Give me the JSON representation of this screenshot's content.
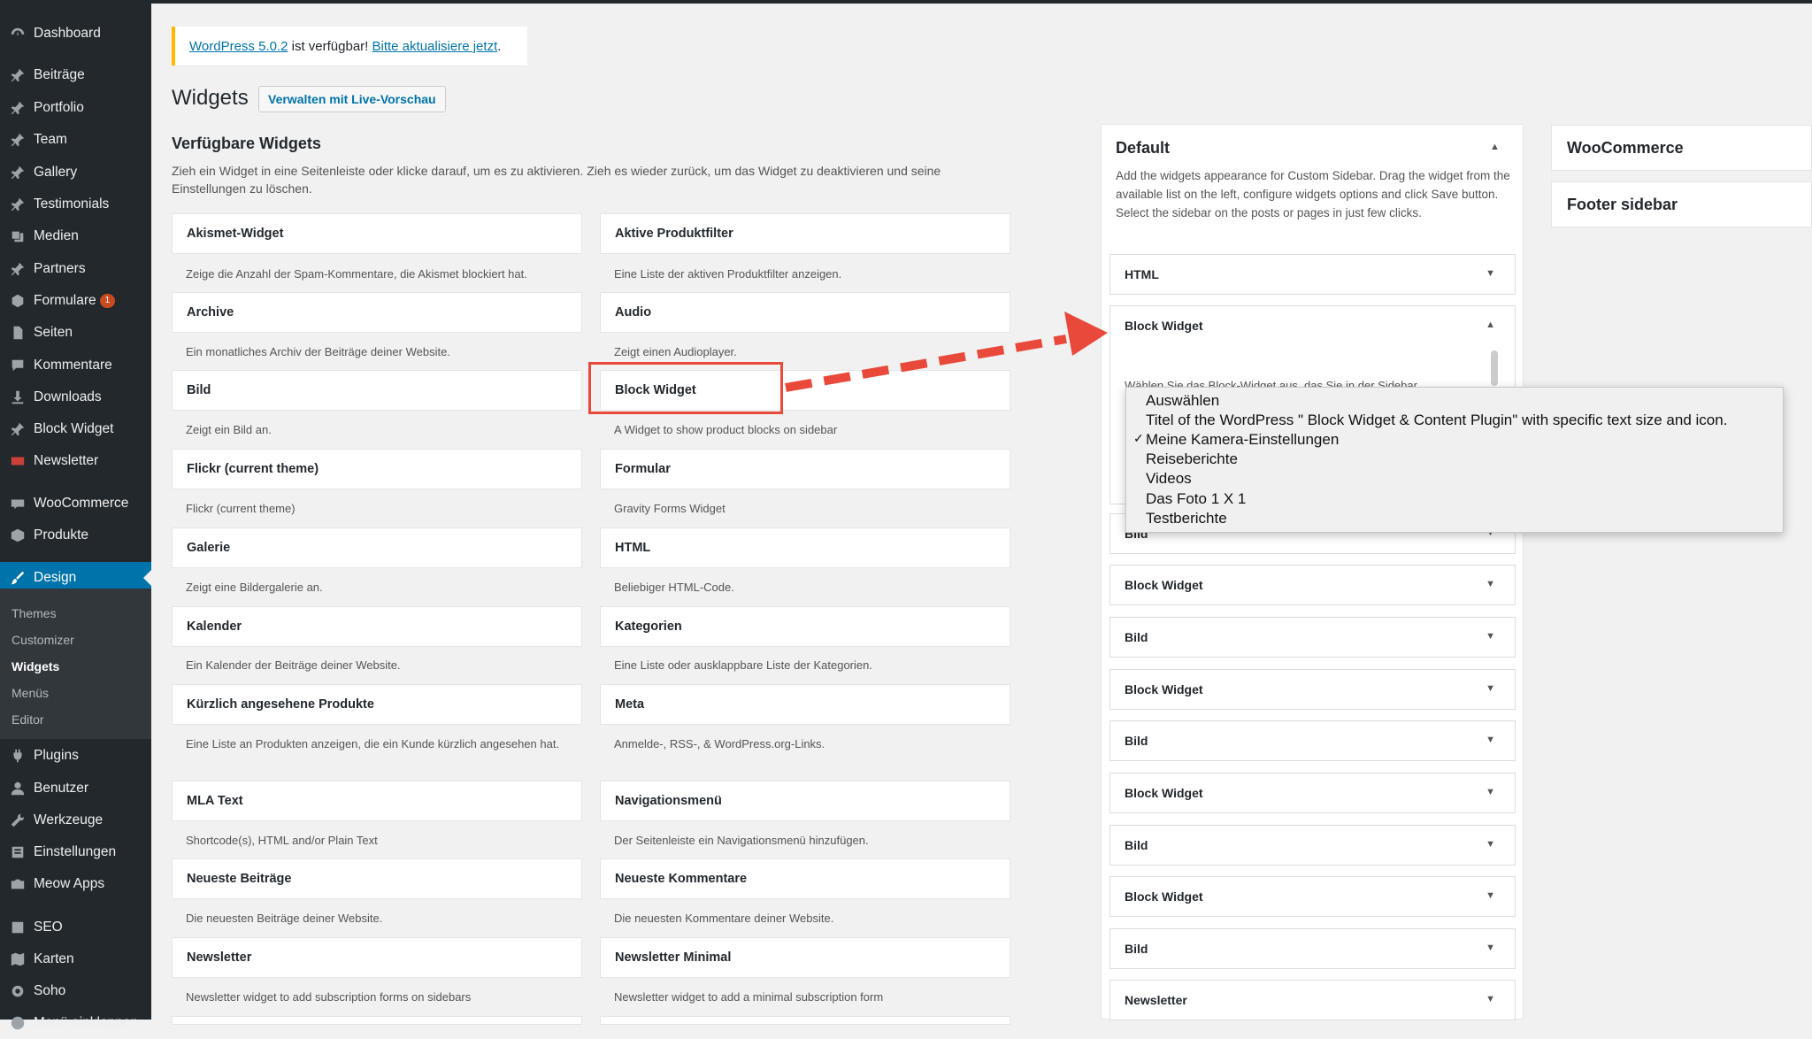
{
  "sidebar": {
    "items": [
      {
        "label": "Dashboard",
        "icon": "dashboard-icon"
      },
      {
        "label": "Beiträge",
        "icon": "pin-icon"
      },
      {
        "label": "Portfolio",
        "icon": "pin-icon"
      },
      {
        "label": "Team",
        "icon": "pin-icon"
      },
      {
        "label": "Gallery",
        "icon": "pin-icon"
      },
      {
        "label": "Testimonials",
        "icon": "pin-icon"
      },
      {
        "label": "Medien",
        "icon": "media-icon"
      },
      {
        "label": "Partners",
        "icon": "pin-icon"
      },
      {
        "label": "Formulare",
        "icon": "forms-icon",
        "badge": "1"
      },
      {
        "label": "Seiten",
        "icon": "page-icon"
      },
      {
        "label": "Kommentare",
        "icon": "comment-icon"
      },
      {
        "label": "Downloads",
        "icon": "download-icon"
      },
      {
        "label": "Block Widget",
        "icon": "pin-icon"
      },
      {
        "label": "Newsletter",
        "icon": "mail-icon"
      },
      {
        "label": "WooCommerce",
        "icon": "woo-icon"
      },
      {
        "label": "Produkte",
        "icon": "box-icon"
      },
      {
        "label": "Design",
        "icon": "brush-icon"
      },
      {
        "label": "Plugins",
        "icon": "plugin-icon"
      },
      {
        "label": "Benutzer",
        "icon": "user-icon"
      },
      {
        "label": "Werkzeuge",
        "icon": "wrench-icon"
      },
      {
        "label": "Einstellungen",
        "icon": "settings-icon"
      },
      {
        "label": "Meow Apps",
        "icon": "camera-icon"
      },
      {
        "label": "SEO",
        "icon": "seo-icon"
      },
      {
        "label": "Karten",
        "icon": "map-icon"
      },
      {
        "label": "Soho",
        "icon": "gear-icon"
      },
      {
        "label": "Menü einklappen",
        "icon": "collapse-icon"
      }
    ],
    "submenu": [
      "Themes",
      "Customizer",
      "Widgets",
      "Menüs",
      "Editor"
    ]
  },
  "notice": {
    "link1": "WordPress 5.0.2",
    "text": " ist verfügbar! ",
    "link2": "Bitte aktualisiere jetzt",
    "end": "."
  },
  "page": {
    "title": "Widgets",
    "action": "Verwalten mit Live-Vorschau",
    "available_title": "Verfügbare Widgets",
    "available_desc": "Zieh ein Widget in eine Seitenleiste oder klicke darauf, um es zu aktivieren. Zieh es wieder zurück, um das Widget zu deaktivieren und seine Einstellungen zu löschen."
  },
  "widgets": [
    {
      "name": "Akismet-Widget",
      "desc": "Zeige die Anzahl der Spam-Kommentare, die Akismet blockiert hat."
    },
    {
      "name": "Aktive Produktfilter",
      "desc": "Eine Liste der aktiven Produktfilter anzeigen."
    },
    {
      "name": "Archive",
      "desc": "Ein monatliches Archiv der Beiträge deiner Website."
    },
    {
      "name": "Audio",
      "desc": "Zeigt einen Audioplayer."
    },
    {
      "name": "Bild",
      "desc": "Zeigt ein Bild an."
    },
    {
      "name": "Block Widget",
      "desc": "A Widget to show product blocks on sidebar"
    },
    {
      "name": "Flickr (current theme)",
      "desc": "Flickr (current theme)"
    },
    {
      "name": "Formular",
      "desc": "Gravity Forms Widget"
    },
    {
      "name": "Galerie",
      "desc": "Zeigt eine Bildergalerie an."
    },
    {
      "name": "HTML",
      "desc": "Beliebiger HTML-Code."
    },
    {
      "name": "Kalender",
      "desc": "Ein Kalender der Beiträge deiner Website."
    },
    {
      "name": "Kategorien",
      "desc": "Eine Liste oder ausklappbare Liste der Kategorien."
    },
    {
      "name": "Kürzlich angesehene Produkte",
      "desc": "Eine Liste an Produkten anzeigen, die ein Kunde kürzlich angesehen hat."
    },
    {
      "name": "Meta",
      "desc": "Anmelde-, RSS-, & WordPress.org-Links."
    },
    {
      "name": "MLA Text",
      "desc": "Shortcode(s), HTML and/or Plain Text"
    },
    {
      "name": "Navigationsmenü",
      "desc": "Der Seitenleiste ein Navigationsmenü hinzufügen."
    },
    {
      "name": "Neueste Beiträge",
      "desc": "Die neuesten Beiträge deiner Website."
    },
    {
      "name": "Neueste Kommentare",
      "desc": "Die neuesten Kommentare deiner Website."
    },
    {
      "name": "Newsletter",
      "desc": "Newsletter widget to add subscription forms on sidebars"
    },
    {
      "name": "Newsletter Minimal",
      "desc": "Newsletter widget to add a minimal subscription form"
    }
  ],
  "default_sidebar": {
    "title": "Default",
    "desc": "Add the widgets appearance for Custom Sidebar. Drag the widget from the available list on the left, configure widgets options and click Save button. Select the sidebar on the posts or pages in just few clicks.",
    "open_widget_text": "Wählen Sie das Block-Widget aus, das Sie in der Sidebar",
    "widgets": [
      "HTML",
      "Block Widget",
      "Bild",
      "Block Widget",
      "Bild",
      "Block Widget",
      "Bild",
      "Block Widget",
      "Bild",
      "Block Widget",
      "Bild",
      "Newsletter"
    ]
  },
  "dropdown": {
    "options": [
      "Auswählen",
      "Titel of the WordPress \" Block Widget & Content Plugin\" with specific text size and icon.",
      "Meine Kamera-Einstellungen",
      "Reiseberichte",
      "Videos",
      "Das Foto 1 X 1",
      "Testberichte"
    ],
    "selected_index": 2
  },
  "other_sidebars": [
    "WooCommerce",
    "Footer sidebar"
  ],
  "colors": {
    "accent": "#0073aa",
    "highlight": "#e8493a",
    "notice": "#ffb900",
    "sidebar": "#23282d"
  }
}
